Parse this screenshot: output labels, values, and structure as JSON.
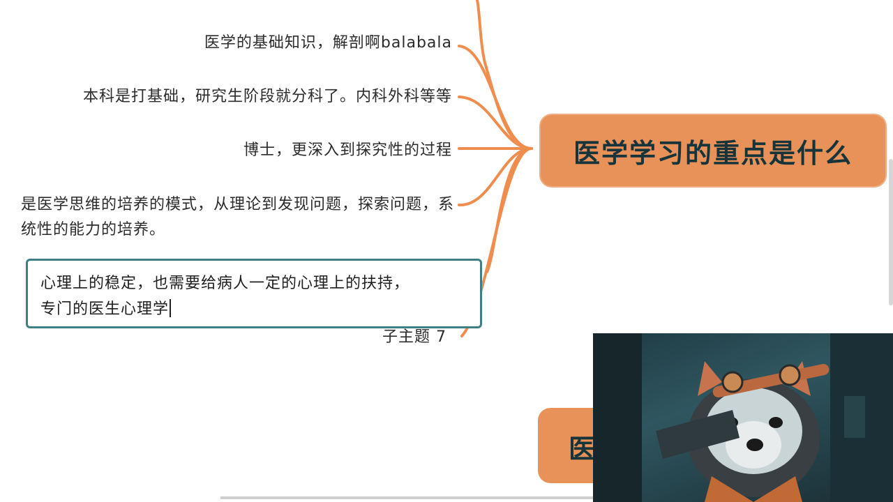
{
  "central_topic": "医学学习的重点是什么",
  "second_topic_partial": "医",
  "branches": [
    {
      "id": "b1",
      "text": "医学的基础知识，解剖啊balabala"
    },
    {
      "id": "b2",
      "text": "本科是打基础，研究生阶段就分科了。内科外科等等"
    },
    {
      "id": "b3",
      "text": "博士，更深入到探究性的过程"
    },
    {
      "id": "b4",
      "text": "是医学思维的培养的模式，从理论到发现问题，探索问题，系统性的能力的培养。"
    }
  ],
  "editing_node": {
    "text": "心理上的稳定，也需要给病人一定的心理上的扶持，\n专门的医生心理学"
  },
  "hidden_node_label": "子主题 7",
  "colors": {
    "accent": "#e8925a",
    "connector": "#ef8d4f",
    "edit_border": "#3e7f86",
    "title_text": "#16343a"
  },
  "webcam_overlay": {
    "icon": "red-panda-avatar"
  }
}
